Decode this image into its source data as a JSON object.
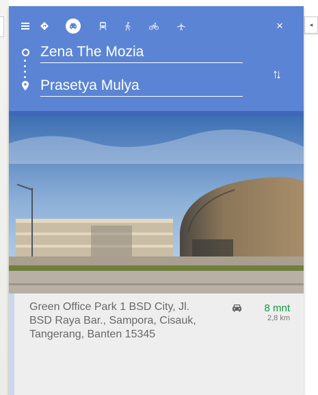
{
  "header": {
    "origin": "Zena The Mozia",
    "destination": "Prasetya Mulya",
    "modes": [
      {
        "icon": "menu-icon"
      },
      {
        "icon": "best-route-icon"
      },
      {
        "icon": "car-icon",
        "active": true
      },
      {
        "icon": "transit-icon"
      },
      {
        "icon": "walking-icon"
      },
      {
        "icon": "cycling-icon"
      },
      {
        "icon": "flight-icon"
      }
    ],
    "close_glyph": "×",
    "swap_icon": "swap-icon"
  },
  "collapse_glyph": "◂",
  "route_option": {
    "address": "Green Office Park 1 BSD City, Jl. BSD Raya Bar., Sampora, Cisauk, Tangerang, Banten 15345",
    "duration": "8 mnt",
    "distance": "2,8 km",
    "mode_icon": "car-icon"
  },
  "colors": {
    "header": "#5b84d4",
    "header_dark": "#3f67b9",
    "duration": "#149a3f",
    "info_bg": "#eeeeee"
  }
}
